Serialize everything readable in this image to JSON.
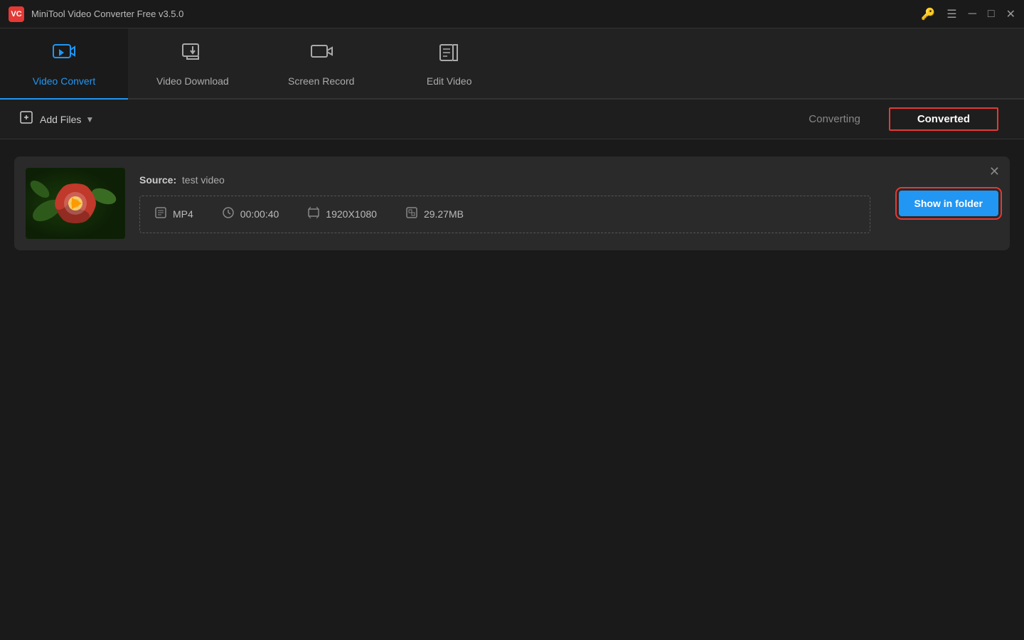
{
  "titleBar": {
    "logo": "VC",
    "title": "MiniTool Video Converter Free v3.5.0",
    "controls": {
      "key_icon": "🔑",
      "menu_icon": "☰",
      "minimize_icon": "─",
      "maximize_icon": "□",
      "close_icon": "✕"
    }
  },
  "navTabs": [
    {
      "id": "video-convert",
      "label": "Video Convert",
      "icon": "⊞",
      "active": true
    },
    {
      "id": "video-download",
      "label": "Video Download",
      "icon": "⊡",
      "active": false
    },
    {
      "id": "screen-record",
      "label": "Screen Record",
      "icon": "⊟",
      "active": false
    },
    {
      "id": "edit-video",
      "label": "Edit Video",
      "icon": "⊠",
      "active": false
    }
  ],
  "toolbar": {
    "add_files_label": "Add Files",
    "tab_converting": "Converting",
    "tab_converted": "Converted"
  },
  "fileCard": {
    "source_label": "Source:",
    "source_name": "test video",
    "format": "MP4",
    "duration": "00:00:40",
    "resolution": "1920X1080",
    "size": "29.27MB",
    "show_folder_btn": "Show in folder"
  }
}
